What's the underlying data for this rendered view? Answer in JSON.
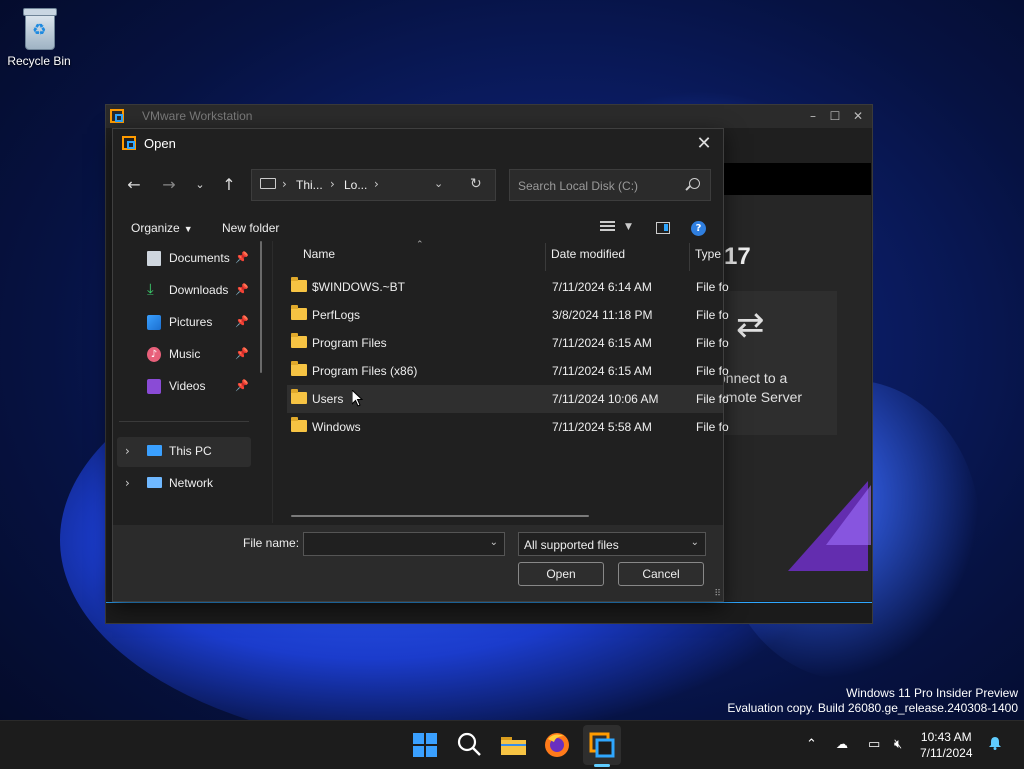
{
  "desktop": {
    "recycle_bin_label": "Recycle Bin"
  },
  "vmware": {
    "title": "VMware Workstation",
    "version_fragment": "17",
    "connect_text_line1": "onnect to a",
    "connect_text_line2": "emote Server"
  },
  "dialog": {
    "title": "Open",
    "address": {
      "segments": [
        "Thi...",
        "Lo..."
      ]
    },
    "search": {
      "placeholder": "Search Local Disk (C:)"
    },
    "toolbar": {
      "organize_label": "Organize",
      "new_folder_label": "New folder"
    },
    "nav": {
      "quick_access": [
        {
          "label": "Documents",
          "icon": "documents-icon"
        },
        {
          "label": "Downloads",
          "icon": "downloads-icon"
        },
        {
          "label": "Pictures",
          "icon": "pictures-icon"
        },
        {
          "label": "Music",
          "icon": "music-icon"
        },
        {
          "label": "Videos",
          "icon": "videos-icon"
        }
      ],
      "tree": [
        {
          "label": "This PC",
          "selected": true
        },
        {
          "label": "Network",
          "selected": false
        }
      ]
    },
    "columns": {
      "name": "Name",
      "date_modified": "Date modified",
      "type": "Type"
    },
    "files": [
      {
        "name": "$WINDOWS.~BT",
        "date": "7/11/2024 6:14 AM",
        "type": "File fo"
      },
      {
        "name": "PerfLogs",
        "date": "3/8/2024 11:18 PM",
        "type": "File fo"
      },
      {
        "name": "Program Files",
        "date": "7/11/2024 6:15 AM",
        "type": "File fo"
      },
      {
        "name": "Program Files (x86)",
        "date": "7/11/2024 6:15 AM",
        "type": "File fo"
      },
      {
        "name": "Users",
        "date": "7/11/2024 10:06 AM",
        "type": "File fo"
      },
      {
        "name": "Windows",
        "date": "7/11/2024 5:58 AM",
        "type": "File fo"
      }
    ],
    "file_name_label": "File name:",
    "file_name_value": "",
    "filter_value": "All supported files",
    "open_label": "Open",
    "cancel_label": "Cancel"
  },
  "watermark": {
    "line1": "Windows 11 Pro Insider Preview",
    "line2": "Evaluation copy. Build 26080.ge_release.240308-1400"
  },
  "taskbar": {
    "time": "10:43 AM",
    "date": "7/11/2024"
  },
  "colors": {
    "accent": "#60cdff",
    "folder": "#f6c343",
    "dialog_bg": "#202020"
  }
}
